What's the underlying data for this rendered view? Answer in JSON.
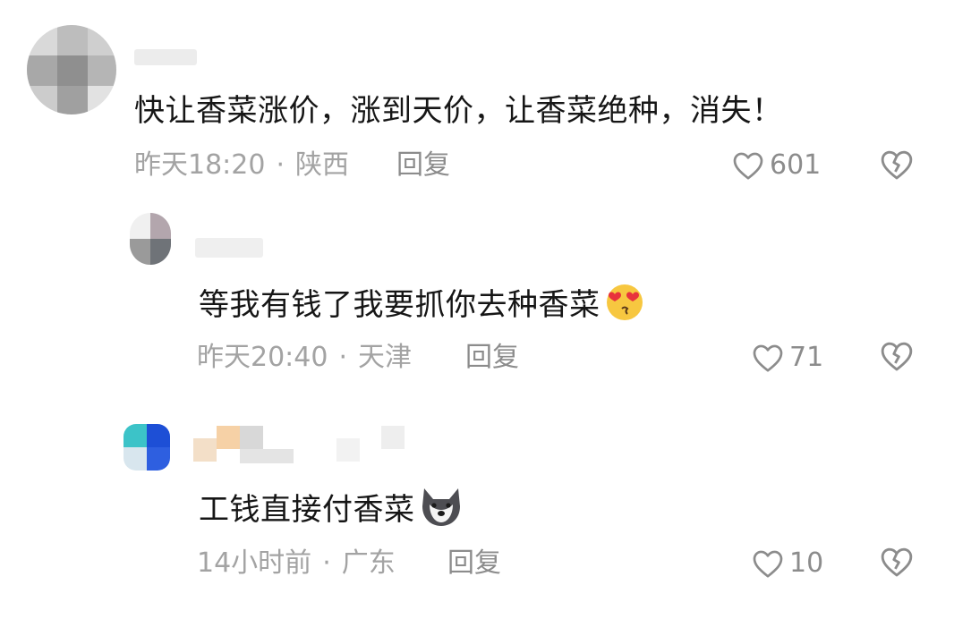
{
  "comments": [
    {
      "text": "快让香菜涨价，涨到天价，让香菜绝种，消失！",
      "time": "昨天18:20",
      "location": "陕西",
      "reply_label": "回复",
      "likes": "601"
    },
    {
      "text": "等我有钱了我要抓你去种香菜",
      "emoji": "heart-eyes-face-icon",
      "time": "昨天20:40",
      "location": "天津",
      "reply_label": "回复",
      "likes": "71"
    },
    {
      "text": "工钱直接付香菜",
      "emoji": "husky-dog-face-icon",
      "time": "14小时前",
      "location": "广东",
      "reply_label": "回复",
      "likes": "10"
    }
  ],
  "separator": "·",
  "colors": {
    "meta": "#a3a3a3",
    "text": "#161616",
    "icon": "#8c8c8c"
  }
}
